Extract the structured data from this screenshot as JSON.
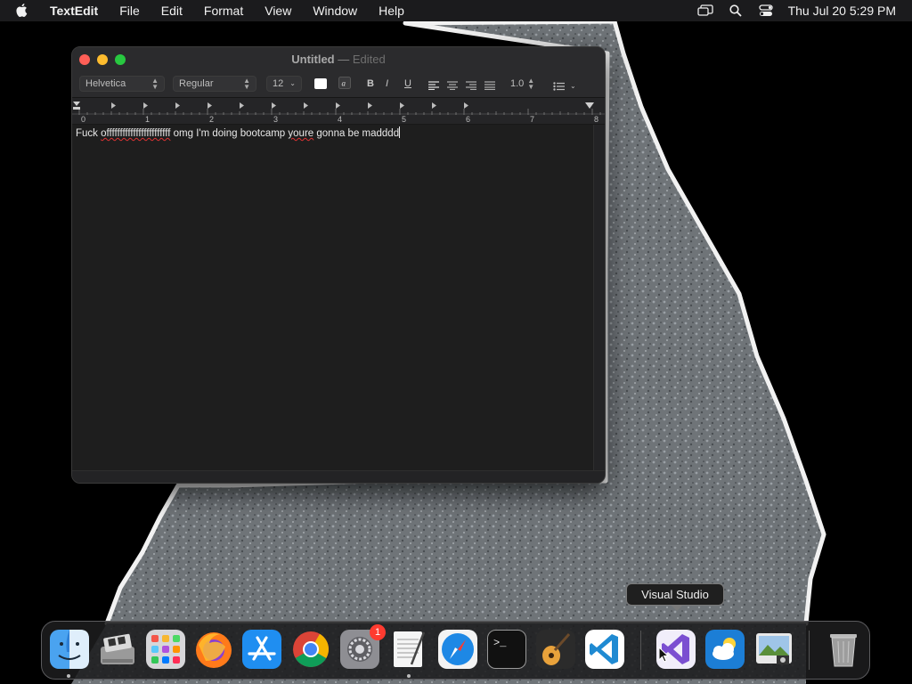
{
  "menubar": {
    "app_name": "TextEdit",
    "menus": [
      "File",
      "Edit",
      "Format",
      "View",
      "Window",
      "Help"
    ],
    "clock": "Thu Jul 20  5:29 PM",
    "status_icons": [
      "screen-mirroring-icon",
      "search-icon",
      "control-center-icon"
    ]
  },
  "window": {
    "title": "Untitled",
    "separator": "—",
    "status": "Edited",
    "toolbar": {
      "font_family": "Helvetica",
      "font_style": "Regular",
      "font_size": "12",
      "bold": "B",
      "italic": "I",
      "underline": "U",
      "line_spacing": "1.0",
      "text_color": "#ffffff"
    },
    "ruler_labels": [
      "0",
      "1",
      "2",
      "3",
      "4",
      "5",
      "6",
      "7",
      "8"
    ],
    "document": {
      "text_part1": "Fuck ",
      "text_part2": "offffffffffffffffffffffff",
      "text_part3": " omg I'm doing bootcamp ",
      "text_part4": "youre",
      "text_part5": " gonna be madddd"
    }
  },
  "tooltip": "Visual Studio",
  "dock": {
    "items": [
      {
        "name": "Finder"
      },
      {
        "name": "Boot Camp Assistant"
      },
      {
        "name": "Launchpad"
      },
      {
        "name": "Firefox"
      },
      {
        "name": "App Store"
      },
      {
        "name": "Google Chrome"
      },
      {
        "name": "System Settings",
        "badge": "1"
      },
      {
        "name": "TextEdit"
      },
      {
        "name": "Safari"
      },
      {
        "name": "Terminal"
      },
      {
        "name": "GarageBand"
      },
      {
        "name": "Visual Studio Code"
      },
      {
        "name": "Visual Studio"
      },
      {
        "name": "Weather"
      },
      {
        "name": "Preview"
      },
      {
        "name": "Trash"
      }
    ]
  },
  "colors": {
    "close": "#ff5f57",
    "minimize": "#febc2e",
    "maximize": "#28c840",
    "badge": "#ff3b30"
  }
}
